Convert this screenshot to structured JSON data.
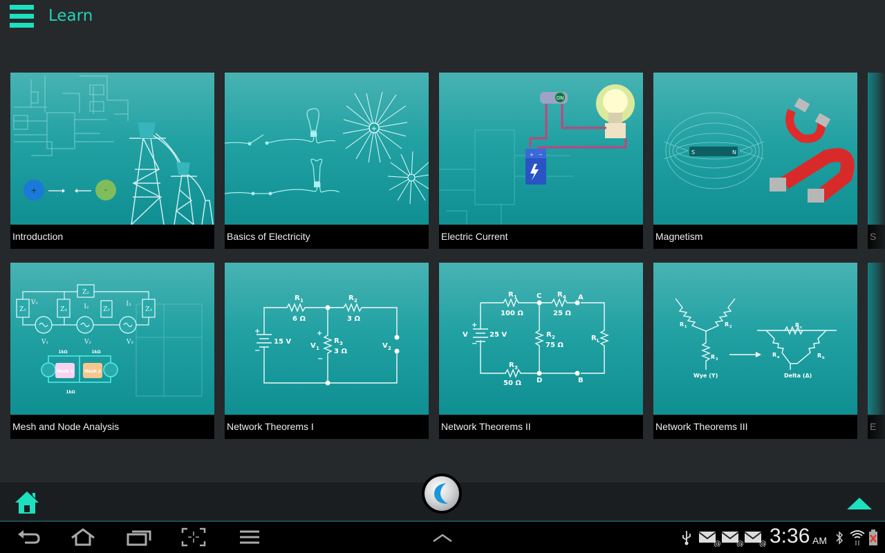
{
  "header": {
    "menu_icon": "hamburger-menu-icon",
    "title": "Learn"
  },
  "theme": {
    "accent": "#1de0bf",
    "background": "#25292b",
    "tile_gradient_top": "#48b3b3",
    "tile_gradient_bottom": "#0f8f92",
    "label_bar": "#000000"
  },
  "tiles": [
    {
      "label": "Introduction",
      "image": "circuit board, charges and power towers"
    },
    {
      "label": "Basics of Electricity",
      "image": "bulbs and electric field lines"
    },
    {
      "label": "Electric Current",
      "image": "battery, switch and light bulb circuit"
    },
    {
      "label": "Magnetism",
      "image": "bar magnet field lines and horseshoe magnets"
    },
    {
      "label": "S",
      "partial": true
    },
    {
      "label": "Mesh and Node Analysis",
      "image": "mesh circuit diagrams"
    },
    {
      "label": "Network Theorems I",
      "image": "resistor circuit with 15 V source"
    },
    {
      "label": "Network Theorems II",
      "image": "bridge circuit with 25 V source"
    },
    {
      "label": "Network Theorems III",
      "image": "wye to delta transformation"
    },
    {
      "label": "E",
      "partial": true
    }
  ],
  "diagrams": {
    "nt1": {
      "R1": "R",
      "R1sub": "1",
      "R1val": "6 Ω",
      "R2": "R",
      "R2sub": "2",
      "R2val": "3 Ω",
      "R3": "R",
      "R3sub": "3",
      "R3val": "3 Ω",
      "src": "15 V",
      "V1": "V",
      "V1sub": "1",
      "V2": "V",
      "V2sub": "2",
      "plus": "+",
      "minus": "−"
    },
    "nt2": {
      "R1val": "100 Ω",
      "R4val": "25 Ω",
      "R2val": "75 Ω",
      "R3val": "50 Ω",
      "src": "25 V",
      "V": "V",
      "C": "C",
      "A": "A",
      "D": "D",
      "B": "B",
      "RL": "R",
      "RLsub": "L",
      "R": "R",
      "s1": "1",
      "s2": "2",
      "s3": "3",
      "s4": "4",
      "plus": "+",
      "minus": "−"
    },
    "nt3": {
      "wye": "Wye (Y)",
      "delta": "Delta (Δ)",
      "R": "R",
      "s1": "1",
      "s2": "2",
      "s3": "3",
      "sa": "a",
      "sb": "b",
      "sc": "c"
    },
    "mesh": {
      "z1": "Z₁",
      "z2": "Z₂",
      "z3": "Z₃",
      "z4": "Z₄",
      "z5": "Z₅",
      "i2": "I₂",
      "i3": "I₃",
      "v1": "V₁",
      "v2": "V₂",
      "v3": "V₃",
      "vi": "V₁",
      "r": "1kΩ",
      "mesh1": "Mesh 1",
      "mesh2": "Mesh 2"
    },
    "magnet": {
      "s": "S",
      "n": "N"
    },
    "current": {
      "switch": "ON",
      "plus": "+",
      "minus": "−"
    },
    "intro": {
      "plus": "+",
      "minus": "-"
    }
  },
  "bottom_bar": {
    "home_icon": "home-icon",
    "logo": "app-logo",
    "scroll_up_icon": "triangle-up-icon"
  },
  "system_nav": {
    "buttons": [
      "back-icon",
      "home-icon",
      "recent-apps-icon",
      "screenshot-icon",
      "menu-icon",
      "chevron-up-icon"
    ]
  },
  "status": {
    "time": "3:36",
    "ampm": "AM",
    "icons": [
      "usb-icon",
      "email-icon",
      "email-icon",
      "email-icon",
      "bluetooth-icon",
      "wifi-icon",
      "battery-icon"
    ]
  }
}
